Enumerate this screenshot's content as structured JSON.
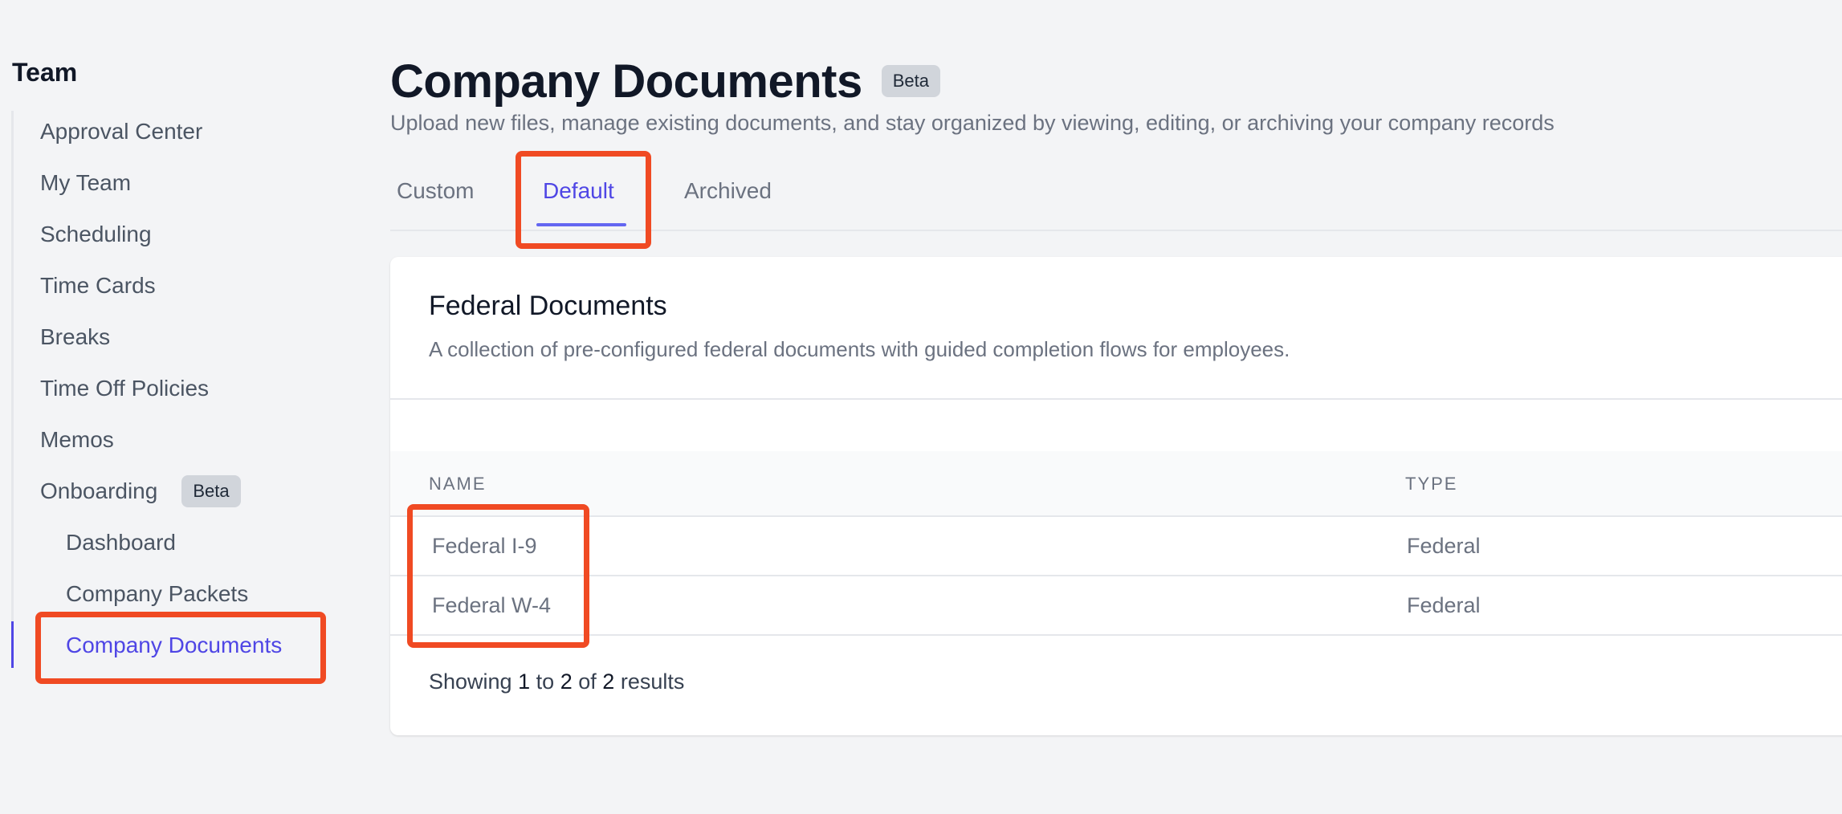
{
  "sidebar": {
    "title": "Team",
    "items": [
      {
        "label": "Approval Center"
      },
      {
        "label": "My Team"
      },
      {
        "label": "Scheduling"
      },
      {
        "label": "Time Cards"
      },
      {
        "label": "Breaks"
      },
      {
        "label": "Time Off Policies"
      },
      {
        "label": "Memos"
      },
      {
        "label": "Onboarding",
        "badge": "Beta"
      }
    ],
    "subitems": [
      {
        "label": "Dashboard"
      },
      {
        "label": "Company Packets"
      },
      {
        "label": "Company Documents",
        "active": true
      }
    ]
  },
  "header": {
    "title": "Company Documents",
    "badge": "Beta",
    "subtitle": "Upload new files, manage existing documents, and stay organized by viewing, editing, or archiving your company records"
  },
  "tabs": [
    {
      "label": "Custom"
    },
    {
      "label": "Default",
      "active": true
    },
    {
      "label": "Archived"
    }
  ],
  "card": {
    "title": "Federal Documents",
    "description": "A collection of pre-configured federal documents with guided completion flows for employees.",
    "columns": [
      "NAME",
      "TYPE"
    ],
    "rows": [
      {
        "name": "Federal I-9",
        "type": "Federal"
      },
      {
        "name": "Federal W-4",
        "type": "Federal"
      }
    ],
    "results": {
      "prefix": "Showing",
      "from": "1",
      "to_word": "to",
      "to": "2",
      "of_word": "of",
      "total": "2",
      "suffix": "results"
    }
  },
  "colors": {
    "accent": "#4f46e5",
    "highlight": "#f04a23",
    "background": "#f3f4f6"
  }
}
